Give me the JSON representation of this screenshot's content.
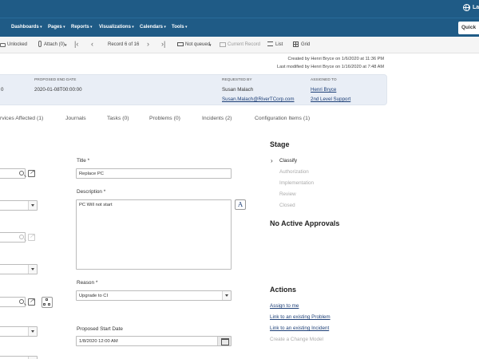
{
  "header": {
    "lang": "La",
    "quick_label": "Quick"
  },
  "nav": {
    "menus": [
      "Dashboards",
      "Pages",
      "Reports",
      "Visualizations",
      "Calendars",
      "Tools"
    ]
  },
  "toolbar": {
    "unlocked": "Unlocked",
    "attach": "Attach (0)",
    "record": "Record 6 of 16",
    "queue": "Not queued",
    "current_record": "Current Record",
    "list": "List",
    "grid": "Grid"
  },
  "meta": {
    "created": "Created by Henri Bryce on 1/6/2020 at 11:36 PM",
    "modified": "Last modified by Henri Bryce on 1/16/2020 at 7:48 AM"
  },
  "summary": {
    "left_value": "0",
    "proposed_end_label": "PROPOSED END DATE",
    "proposed_end_value": "2020-01-08T00:00:00",
    "requested_by_label": "REQUESTED BY",
    "requested_by_name": "Susan Malach",
    "requested_by_email": "Susan.Malach@RiverTCorp.com",
    "assigned_to_label": "ASSIGNED TO",
    "assigned_to_name": "Henri Bryce",
    "assigned_group": "2nd Level Support"
  },
  "tabs": [
    "rvices Affected (1)",
    "Journals",
    "Tasks (0)",
    "Problems (0)",
    "Incidents (2)",
    "Configuration Items (1)"
  ],
  "form": {
    "title_label": "Title",
    "title_value": "Replace PC",
    "description_label": "Description",
    "description_value": "PC Will not start",
    "reason_label": "Reason",
    "reason_value": "Upgrade to CI",
    "start_date_label": "Proposed Start Date",
    "start_date_value": "1/8/2020 12:00 AM",
    "required_mark": "*"
  },
  "stage": {
    "title": "Stage",
    "items": [
      "Classify",
      "Authorization",
      "Implementation",
      "Review",
      "Closed"
    ],
    "active_index": 0
  },
  "approvals": {
    "title": "No Active Approvals"
  },
  "actions": {
    "title": "Actions",
    "items": [
      "Assign to me",
      "Link to an existing Problem",
      "Link to an existing Incident",
      "Create a Change Model"
    ]
  },
  "colors": {
    "nav_bg": "#1f5b86",
    "summary_bg": "#e9eef6",
    "link": "#1d3f77"
  }
}
